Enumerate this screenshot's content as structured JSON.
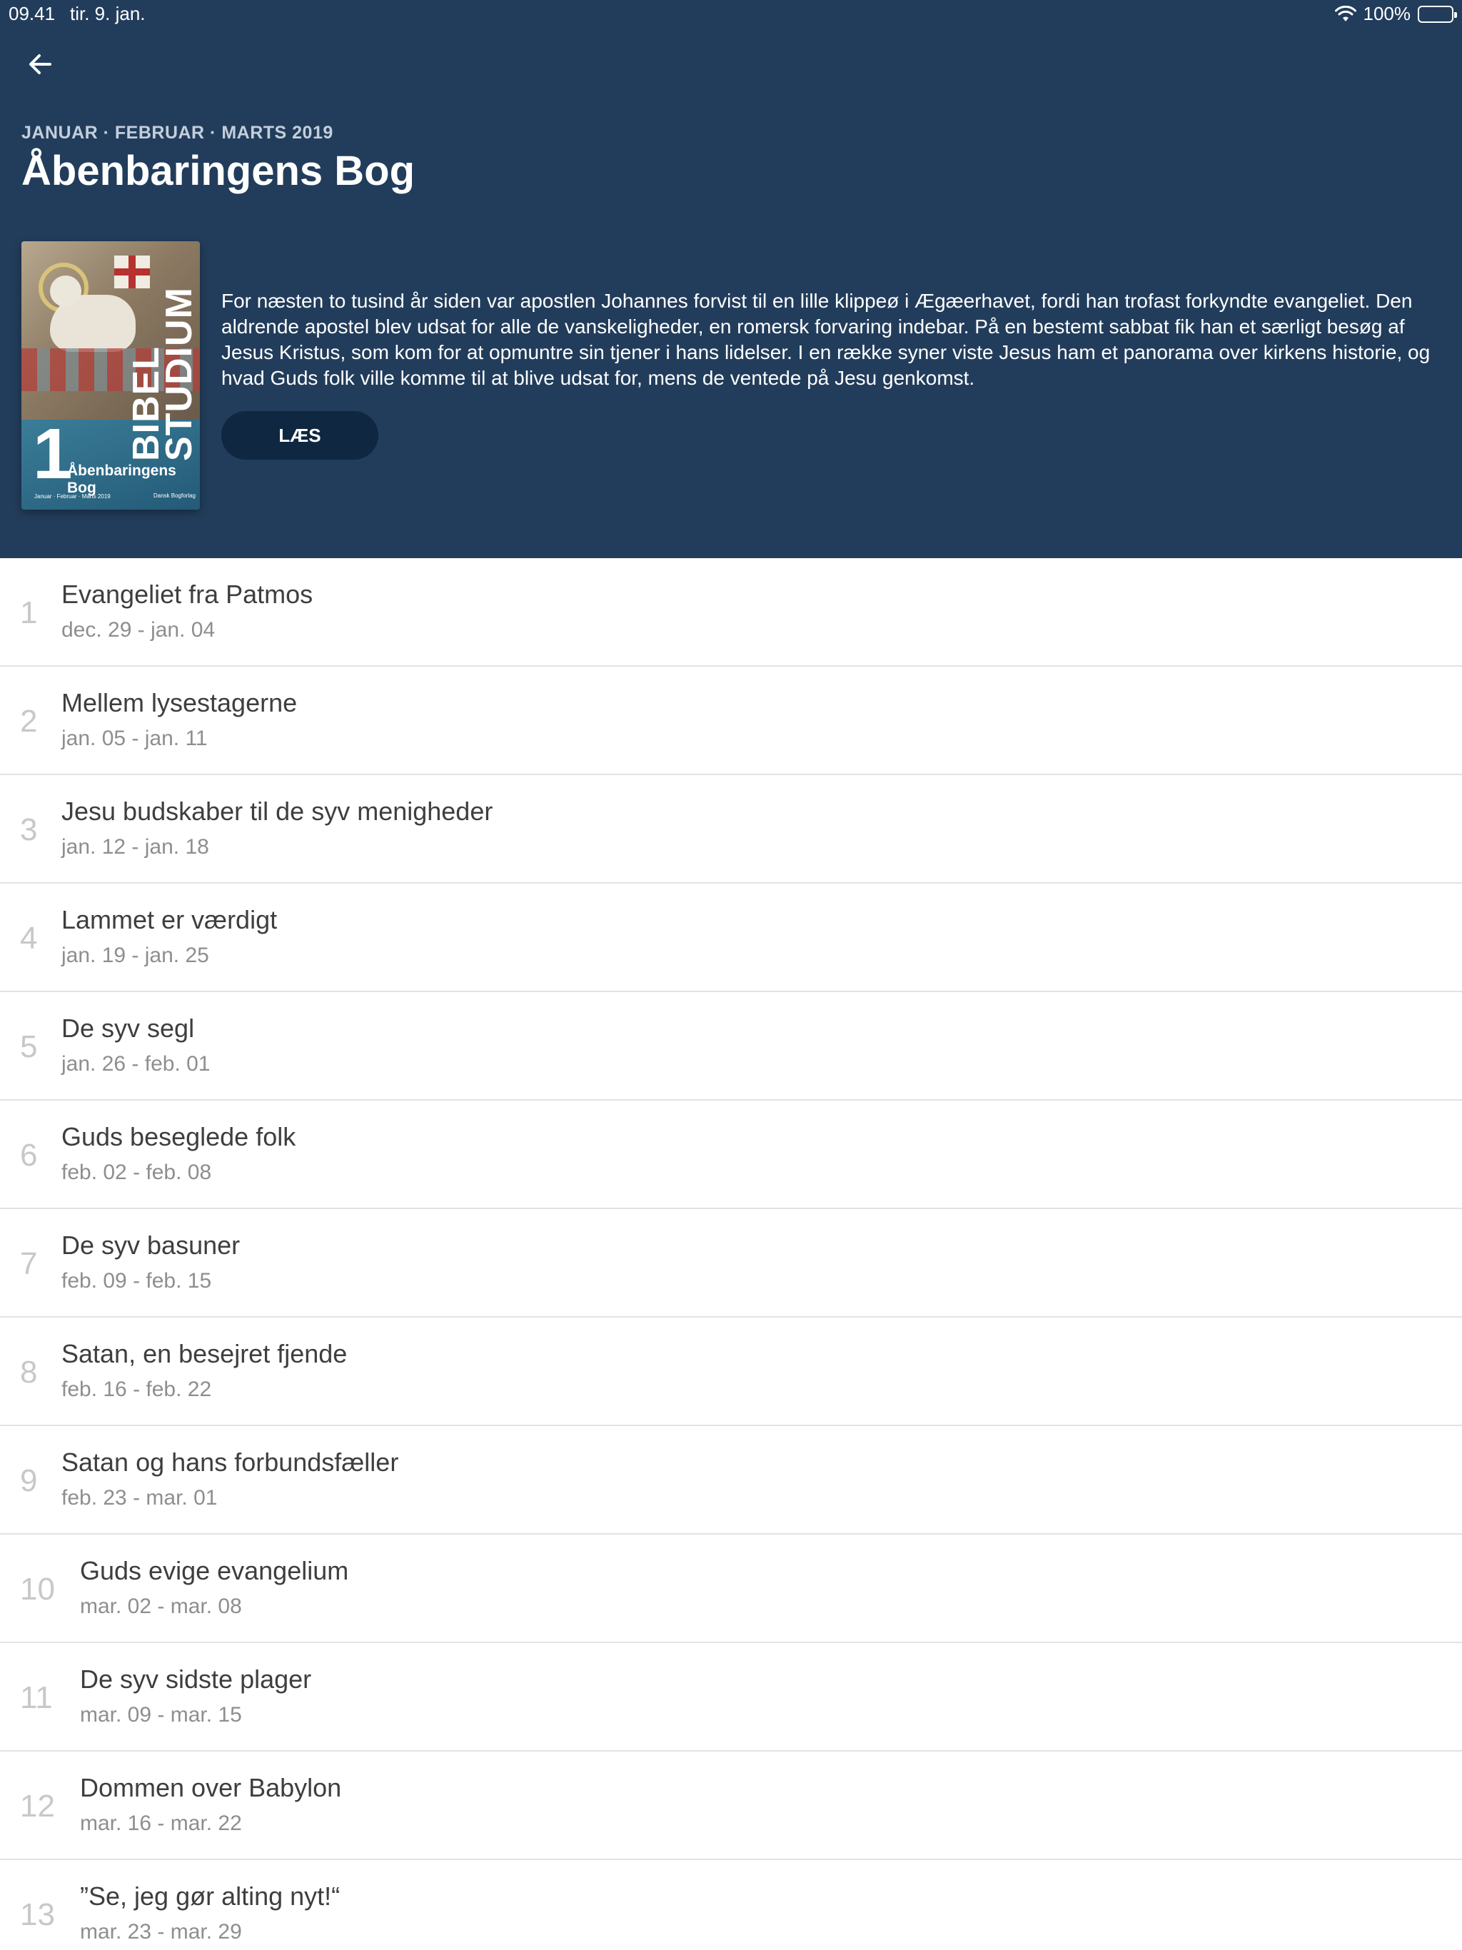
{
  "status": {
    "time": "09.41",
    "date": "tir. 9. jan.",
    "battery": "100%"
  },
  "header": {
    "quarter": "JANUAR · FEBRUAR · MARTS 2019",
    "title": "Åbenbaringens Bog",
    "description": "For næsten to tusind år siden var apostlen Johannes forvist til en lille klippeø i Ægæerhavet, fordi han trofast forkyndte evangeliet. Den aldrende apostel blev udsat for alle de vanskeligheder, en romersk forvaring indebar. På en bestemt sabbat fik han et særligt besøg af Jesus Kristus, som kom for at opmuntre sin tjener i hans lidelser. I en række syner viste Jesus ham et panorama over kirkens historie, og hvad Guds folk ville komme til at blive udsat for, mens de ventede på Jesu genkomst.",
    "read_label": "LÆS"
  },
  "cover": {
    "vertical_text": "BIBEL STUDIUM",
    "number": "1",
    "subtitle": "Åbenbaringens Bog",
    "footer": "Januar · Februar · Marts 2019",
    "logo": "Dansk Bogforlag"
  },
  "colors": {
    "header_bg": "#223d5b",
    "button_bg": "#0f2740",
    "quarter_text": "#c3cfdb"
  },
  "icons": {
    "back": "arrow-left-icon",
    "wifi": "wifi-icon",
    "battery": "battery-icon"
  },
  "lessons": [
    {
      "number": "1",
      "title": "Evangeliet fra Patmos",
      "dates": "dec. 29 - jan. 04"
    },
    {
      "number": "2",
      "title": "Mellem lysestagerne",
      "dates": "jan. 05 - jan. 11"
    },
    {
      "number": "3",
      "title": "Jesu budskaber til de syv menigheder",
      "dates": "jan. 12 - jan. 18"
    },
    {
      "number": "4",
      "title": "Lammet er værdigt",
      "dates": "jan. 19 - jan. 25"
    },
    {
      "number": "5",
      "title": "De syv segl",
      "dates": "jan. 26 - feb. 01"
    },
    {
      "number": "6",
      "title": "Guds beseglede folk",
      "dates": "feb. 02 - feb. 08"
    },
    {
      "number": "7",
      "title": "De syv basuner",
      "dates": "feb. 09 - feb. 15"
    },
    {
      "number": "8",
      "title": "Satan, en besejret fjende",
      "dates": "feb. 16 - feb. 22"
    },
    {
      "number": "9",
      "title": "Satan og hans forbundsfæller",
      "dates": "feb. 23 - mar. 01"
    },
    {
      "number": "10",
      "title": "Guds evige evangelium",
      "dates": "mar. 02 - mar. 08"
    },
    {
      "number": "11",
      "title": "De syv sidste plager",
      "dates": "mar. 09 - mar. 15"
    },
    {
      "number": "12",
      "title": "Dommen over Babylon",
      "dates": "mar. 16 - mar. 22"
    },
    {
      "number": "13",
      "title": "”Se, jeg gør alting nyt!“",
      "dates": "mar. 23 - mar. 29"
    }
  ]
}
